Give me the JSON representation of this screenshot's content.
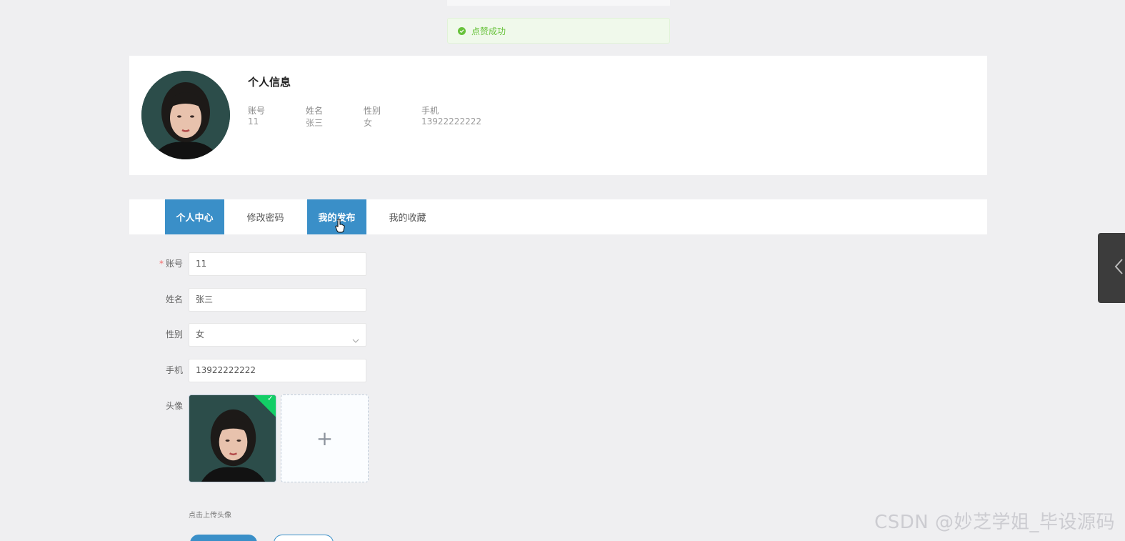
{
  "toast": {
    "message": "点赞成功",
    "icon": "check-circle-icon",
    "color": "#67c23a"
  },
  "profile": {
    "title": "个人信息",
    "fields": [
      {
        "label": "账号",
        "value": "11"
      },
      {
        "label": "姓名",
        "value": "张三"
      },
      {
        "label": "性别",
        "value": "女"
      },
      {
        "label": "手机",
        "value": "13922222222"
      }
    ]
  },
  "tabs": [
    {
      "label": "个人中心",
      "active": true
    },
    {
      "label": "修改密码",
      "active": false
    },
    {
      "label": "我的发布",
      "active": true
    },
    {
      "label": "我的收藏",
      "active": false
    }
  ],
  "form": {
    "account": {
      "label": "账号",
      "required_mark": "*",
      "value": "11"
    },
    "name": {
      "label": "姓名",
      "value": "张三"
    },
    "gender": {
      "label": "性别",
      "value": "女"
    },
    "phone": {
      "label": "手机",
      "value": "13922222222"
    },
    "avatar": {
      "label": "头像",
      "hint": "点击上传头像",
      "add_icon": "plus-icon"
    }
  },
  "watermark": "CSDN @妙芝学姐_毕设源码",
  "colors": {
    "accent": "#3a8fc8",
    "success": "#13ce66",
    "required": "#f56c6c"
  }
}
